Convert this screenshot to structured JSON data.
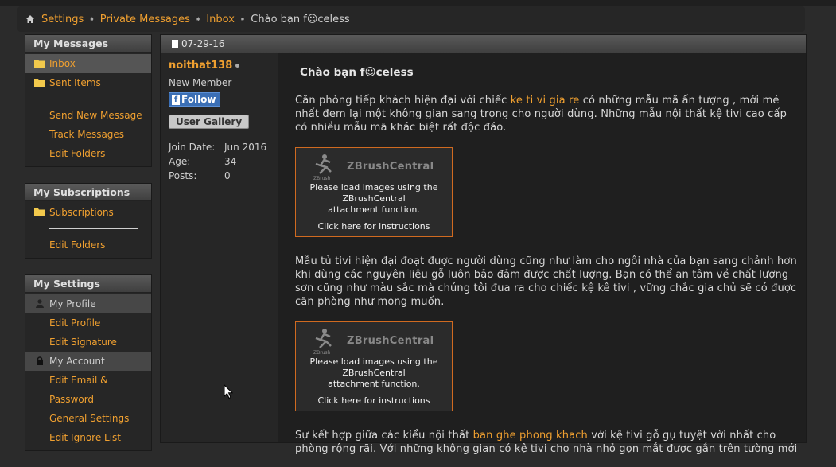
{
  "breadcrumb": {
    "items": [
      "Settings",
      "Private Messages",
      "Inbox"
    ],
    "current": "Chào bạn f☺celess"
  },
  "sidebar": {
    "my_messages": {
      "title": "My Messages",
      "folders": [
        "Inbox",
        "Sent Items"
      ],
      "links": [
        "Send New Message",
        "Track Messages",
        "Edit Folders"
      ]
    },
    "my_subscriptions": {
      "title": "My Subscriptions",
      "folders": [
        "Subscriptions"
      ],
      "links": [
        "Edit Folders"
      ]
    },
    "my_settings": {
      "title": "My Settings",
      "profile_label": "My Profile",
      "profile_links": [
        "Edit Profile",
        "Edit Signature"
      ],
      "account_label": "My Account",
      "account_links": [
        "Edit Email &",
        "Password",
        "General Settings",
        "Edit Ignore List"
      ]
    }
  },
  "post": {
    "date": "07-29-16",
    "user": {
      "name": "noithat138",
      "title": "New Member",
      "follow": "Follow",
      "gallery": "User Gallery",
      "stats": [
        {
          "label": "Join Date:",
          "value": "Jun 2016"
        },
        {
          "label": "Age:",
          "value": "34"
        },
        {
          "label": "Posts:",
          "value": "0"
        }
      ]
    },
    "title": "Chào bạn f☺celess",
    "p1_a": "Căn phòng tiếp khách hiện đại với chiếc ",
    "p1_link": "ke ti vi gia re",
    "p1_b": " có những mẫu mã ấn tượng , mới mẻ nhất đem lại một không gian sang trọng cho người dùng. Những mẫu nội thất kệ tivi cao cấp có nhiều mẫu mã khác biệt rất độc đáo.",
    "p2": "Mẫu tủ tivi hiện đại đoạt được người dùng cũng như làm cho ngôi nhà của bạn sang chảnh hơn khi dùng các nguyên liệu gỗ luôn bảo đảm được chất lượng. Bạn có thể an tâm về chất lượng sơn cũng như màu sắc mà chúng tôi đưa ra cho chiếc kệ kê tivi , vững chắc gia chủ sẽ có được căn phòng như mong muốn.",
    "p3_a": "Sự kết hợp giữa các kiểu nội thất ",
    "p3_link": "ban ghe phong khach",
    "p3_b": " với kệ tivi gỗ gụ tuyệt vời nhất cho phòng rộng rãi. Với những không gian có kệ tivi cho nhà nhỏ gọn mắt được gắn trên tường mới",
    "image_placeholder": {
      "brand": "ZBrushCentral",
      "logo_sub": "ZBrush",
      "message_1": "Please load images using the",
      "message_2": "ZBrushCentral",
      "message_3": "attachment function.",
      "click": "Click here for instructions"
    }
  },
  "colors": {
    "link": "#f0a030",
    "background": "#2b2b2b",
    "placeholder_border": "#d06a20"
  }
}
